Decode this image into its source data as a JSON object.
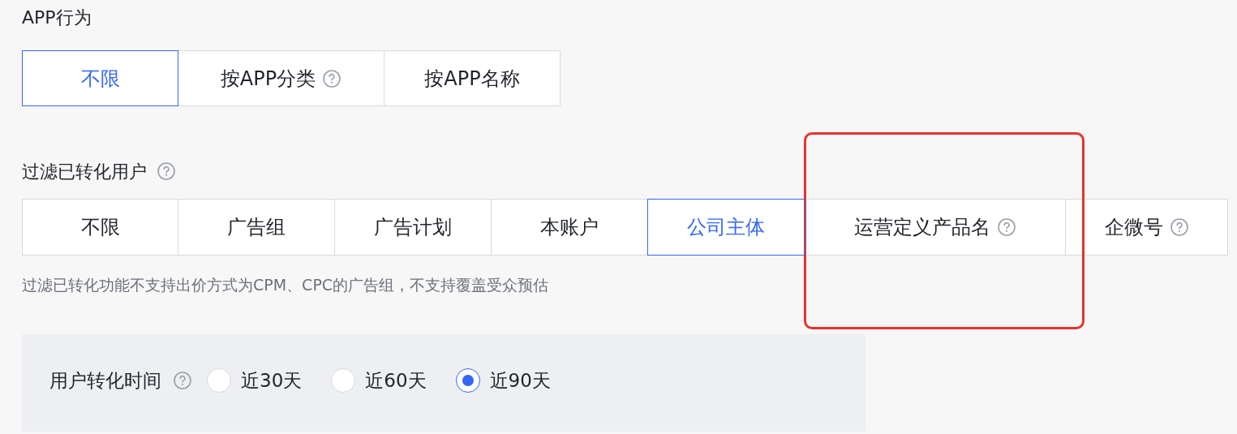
{
  "app_behavior": {
    "title": "APP行为",
    "options": [
      {
        "label": "不限",
        "selected": true,
        "help": false
      },
      {
        "label": "按APP分类",
        "selected": false,
        "help": true
      },
      {
        "label": "按APP名称",
        "selected": false,
        "help": false
      }
    ]
  },
  "filter_converted": {
    "title": "过滤已转化用户",
    "help": true,
    "options": [
      {
        "label": "不限",
        "selected": false,
        "help": false
      },
      {
        "label": "广告组",
        "selected": false,
        "help": false
      },
      {
        "label": "广告计划",
        "selected": false,
        "help": false
      },
      {
        "label": "本账户",
        "selected": false,
        "help": false
      },
      {
        "label": "公司主体",
        "selected": true,
        "help": false
      },
      {
        "label": "运营定义产品名",
        "selected": false,
        "help": true
      },
      {
        "label": "企微号",
        "selected": false,
        "help": true
      }
    ],
    "hint": "过滤已转化功能不支持出价方式为CPM、CPC的广告组，不支持覆盖受众预估"
  },
  "conversion_time": {
    "label": "用户转化时间",
    "help": true,
    "options": [
      {
        "label": "近30天",
        "selected": false
      },
      {
        "label": "近60天",
        "selected": false
      },
      {
        "label": "近90天",
        "selected": true
      }
    ]
  }
}
